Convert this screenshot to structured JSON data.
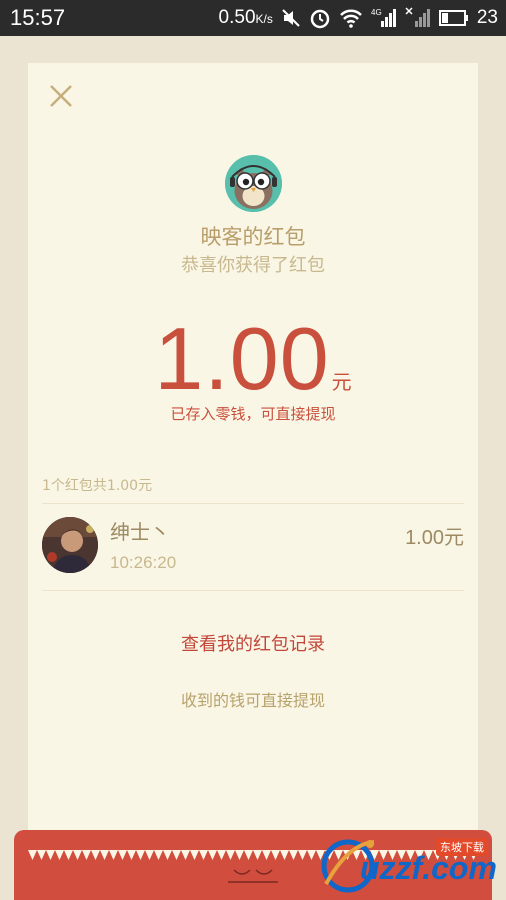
{
  "status_bar": {
    "time": "15:57",
    "network_speed": "0.50",
    "network_speed_unit": "K/s",
    "battery": "23",
    "icons": [
      "mute-icon",
      "alarm-icon",
      "wifi-icon",
      "signal-4g-icon",
      "signal-no-service-icon",
      "battery-icon"
    ]
  },
  "red_packet": {
    "close_icon": "close-icon",
    "logo_icon": "owl-logo-icon",
    "sender_label": "映客的红包",
    "greeting": "恭喜你获得了红包",
    "amount": "1.00",
    "amount_unit": "元",
    "saved_note": "已存入零钱，可直接提现",
    "summary": "1个红包共1.00元",
    "records": [
      {
        "name": "绅士丶",
        "time": "10:26:20",
        "amount": "1.00元"
      }
    ],
    "view_records_link": "查看我的红包记录",
    "withdraw_note": "收到的钱可直接提现"
  },
  "watermark": {
    "text": "uzzf.com",
    "badge": "东坡下载"
  },
  "colors": {
    "accent_red": "#c9503c",
    "gold_text": "#b89e6a",
    "panel_bg": "#faf6e6",
    "page_bg": "#ece4d2",
    "bottom_red": "#d14d3d"
  }
}
